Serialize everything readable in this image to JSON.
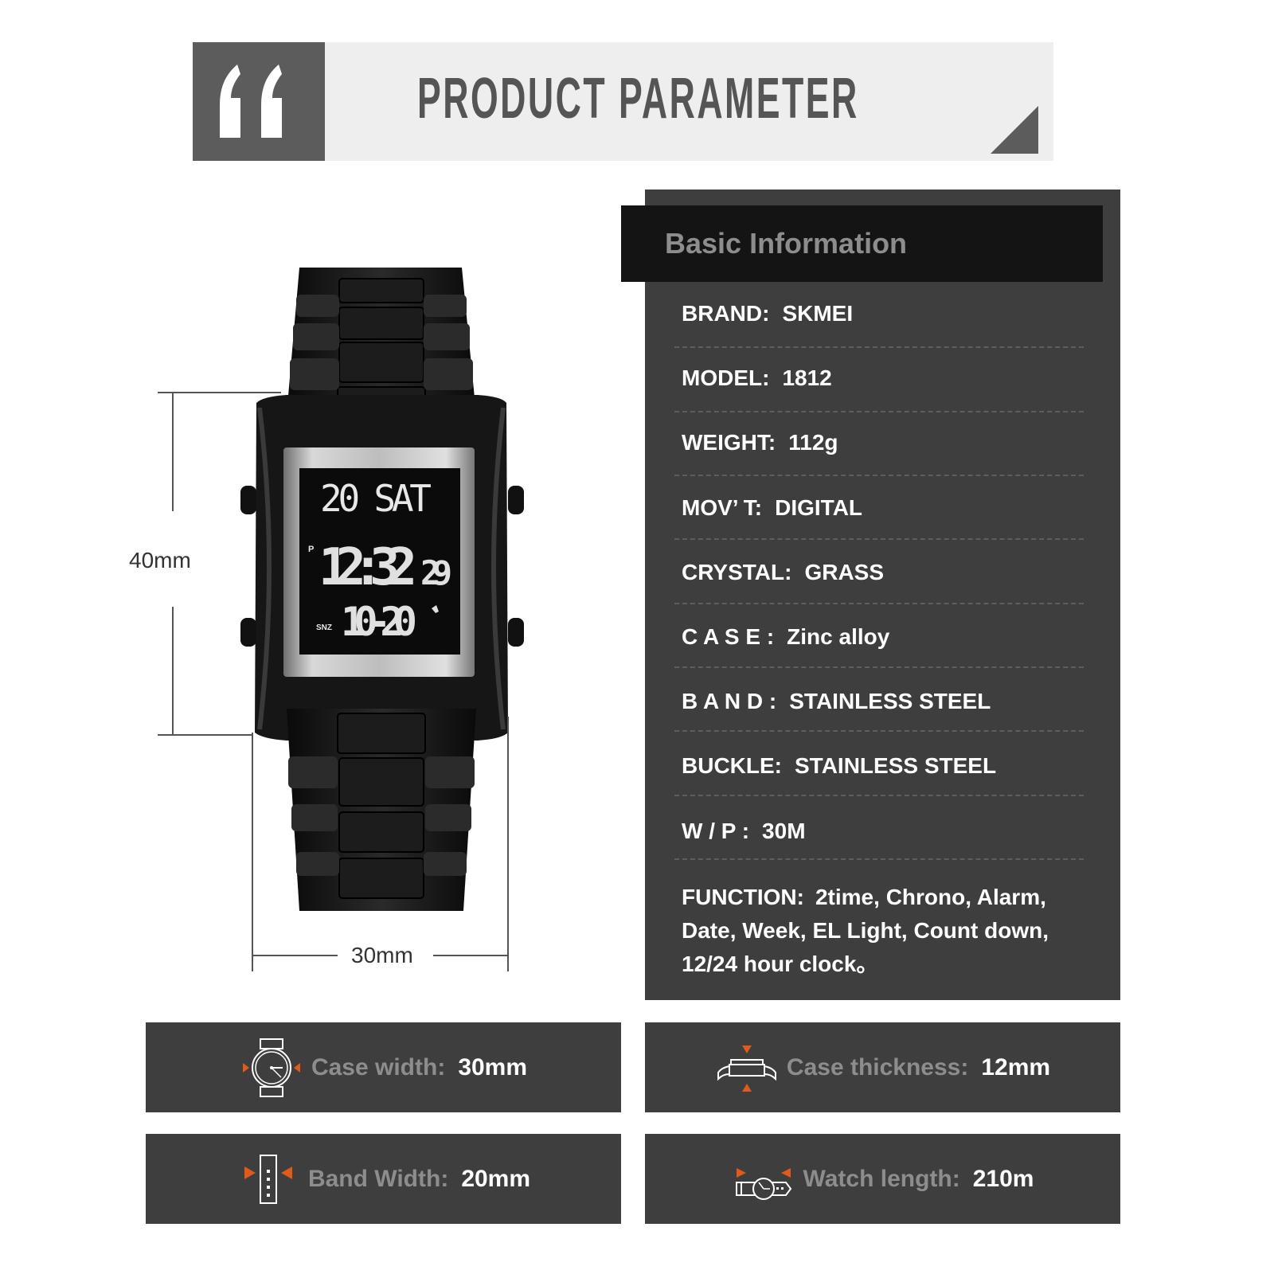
{
  "header": {
    "title": "PRODUCT PARAMETER",
    "colors": {
      "band": "#eeeeee",
      "accent": "#5c5c5c"
    }
  },
  "basic_info": {
    "title": "Basic Information",
    "rows": [
      {
        "key": "BRAND:",
        "value": "SKMEI"
      },
      {
        "key": "MODEL:",
        "value": "1812"
      },
      {
        "key": "WEIGHT:",
        "value": "112g"
      },
      {
        "key": "MOV’ T:",
        "value": "DIGITAL"
      },
      {
        "key": "CRYSTAL:",
        "value": "GRASS"
      },
      {
        "key": "C A S E :",
        "value": "Zinc alloy"
      },
      {
        "key": "B A N D :",
        "value": "STAINLESS STEEL"
      },
      {
        "key": "BUCKLE:",
        "value": "STAINLESS STEEL"
      },
      {
        "key": "W / P :",
        "value": "30M"
      }
    ],
    "function": {
      "key": "FUNCTION:",
      "value": "2time, Chrono, Alarm, Date, Week, EL Light, Count down, 12/24 hour clock。"
    }
  },
  "watch": {
    "display": {
      "date_line": "20 SAT",
      "pm_indicator": "P",
      "time": "12:32",
      "seconds": "29",
      "snooze_label": "SNZ",
      "alarm_time": "10-20",
      "alarm_icon": "bell-icon"
    },
    "dimensions": {
      "height": "40mm",
      "width": "30mm"
    }
  },
  "spec_cards": [
    {
      "icon": "case-width-icon",
      "label": "Case width:",
      "value": "30mm"
    },
    {
      "icon": "case-thickness-icon",
      "label": "Case thickness:",
      "value": "12mm"
    },
    {
      "icon": "band-width-icon",
      "label": "Band Width:",
      "value": "20mm"
    },
    {
      "icon": "watch-length-icon",
      "label": "Watch length:",
      "value": "210m"
    }
  ],
  "colors": {
    "panel": "#3e3e3e",
    "panel_header": "#141414",
    "arrow_accent": "#e05a1c",
    "muted_text": "#8d8d8d"
  }
}
